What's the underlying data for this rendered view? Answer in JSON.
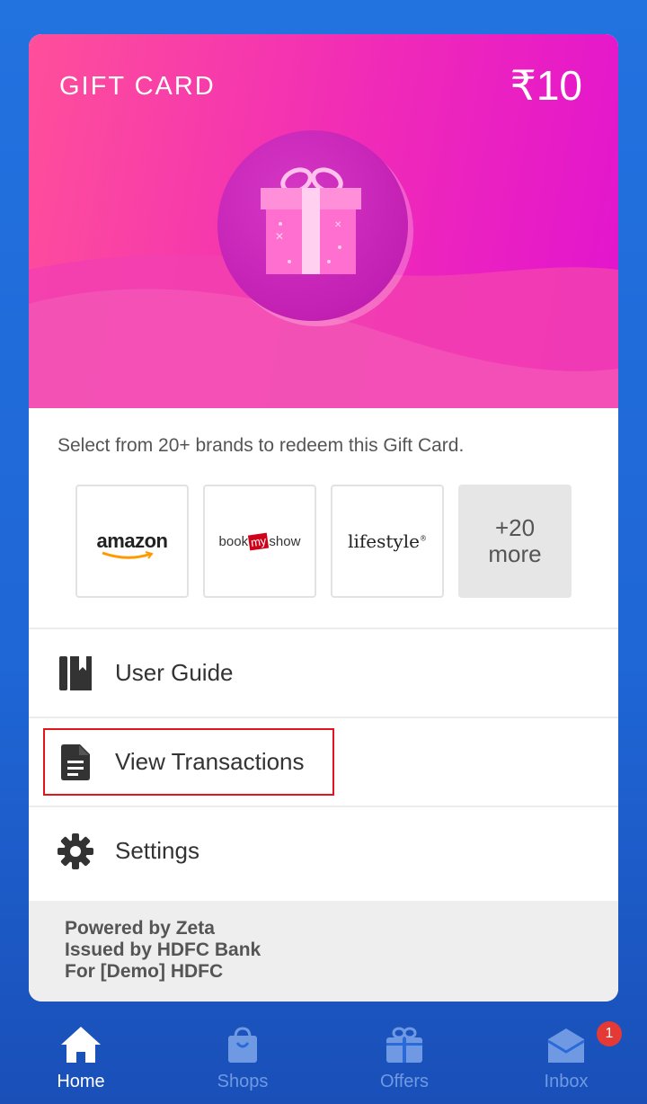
{
  "gift_card": {
    "title": "GIFT CARD",
    "amount": "₹10"
  },
  "redeem": {
    "text": "Select from 20+ brands to redeem this Gift Card.",
    "brands": [
      {
        "name": "amazon"
      },
      {
        "name_part1": "book",
        "name_part2": "my",
        "name_part3": "show"
      },
      {
        "name": "lifestyle"
      }
    ],
    "more": {
      "count": "+20",
      "label": "more"
    }
  },
  "menu": [
    {
      "label": "User Guide",
      "icon": "book-icon"
    },
    {
      "label": "View Transactions",
      "icon": "document-icon"
    },
    {
      "label": "Settings",
      "icon": "gear-icon"
    }
  ],
  "footer": {
    "line1": "Powered by Zeta",
    "line2": "Issued by HDFC Bank",
    "line3": "For [Demo] HDFC"
  },
  "tabs": [
    {
      "label": "Home",
      "icon": "home-icon",
      "active": true
    },
    {
      "label": "Shops",
      "icon": "shopping-bag-icon",
      "active": false
    },
    {
      "label": "Offers",
      "icon": "gift-icon",
      "active": false
    },
    {
      "label": "Inbox",
      "icon": "mail-icon",
      "active": false,
      "badge": "1"
    }
  ],
  "colors": {
    "background": "#1f66d6",
    "card_gradient_start": "#ff4f9a",
    "card_gradient_end": "#e214cf",
    "highlight": "#e3141c",
    "badge": "#e53935"
  }
}
